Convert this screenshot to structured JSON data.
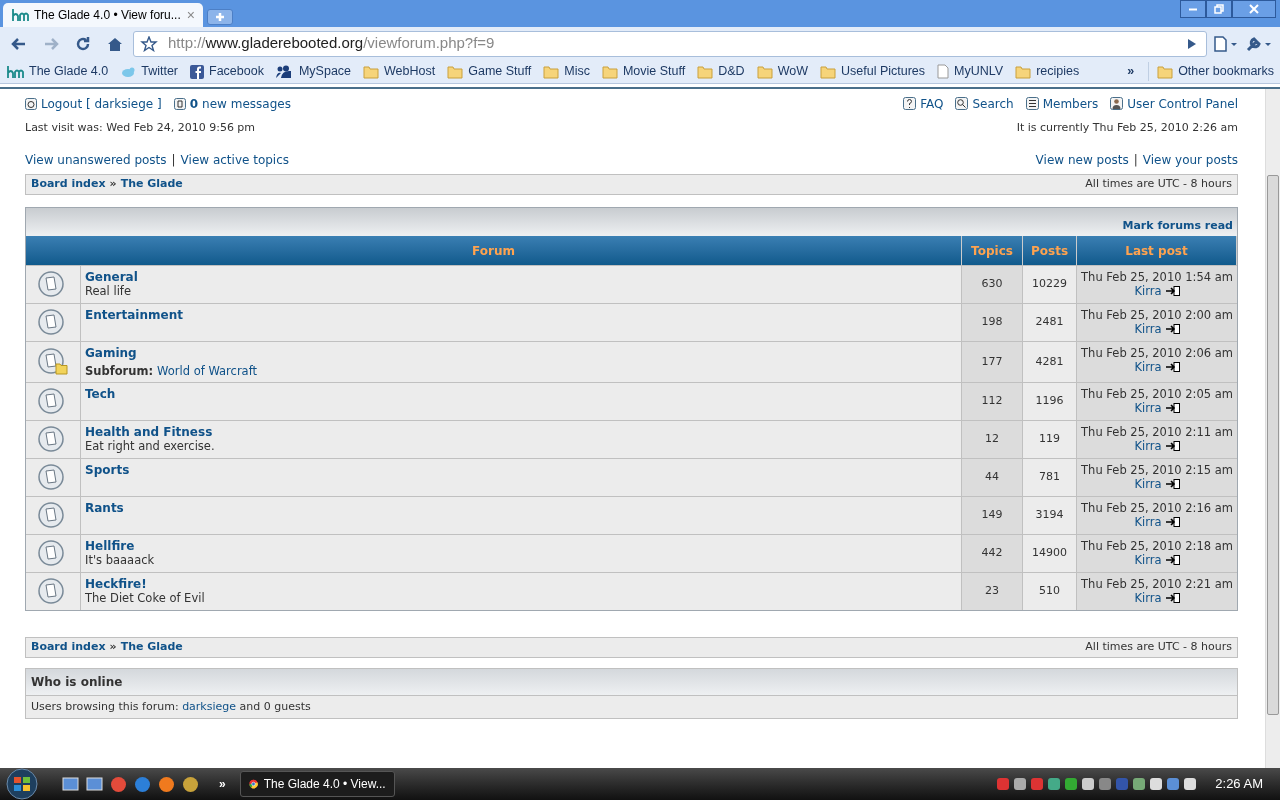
{
  "browser": {
    "tab_title": "The Glade 4.0 • View foru...",
    "tab_close": "×",
    "address": {
      "scheme": "http://",
      "domain": "www.gladerebooted.org",
      "path": "/viewforum.php?f=9"
    },
    "bookmarks": [
      {
        "label": "The Glade 4.0",
        "kind": "site"
      },
      {
        "label": "Twitter",
        "kind": "twitter"
      },
      {
        "label": "Facebook",
        "kind": "facebook"
      },
      {
        "label": "MySpace",
        "kind": "myspace"
      },
      {
        "label": "WebHost",
        "kind": "folder"
      },
      {
        "label": "Game Stuff",
        "kind": "folder"
      },
      {
        "label": "Misc",
        "kind": "folder"
      },
      {
        "label": "Movie Stuff",
        "kind": "folder"
      },
      {
        "label": "D&D",
        "kind": "folder"
      },
      {
        "label": "WoW",
        "kind": "folder"
      },
      {
        "label": "Useful Pictures",
        "kind": "folder"
      },
      {
        "label": "MyUNLV",
        "kind": "page"
      },
      {
        "label": "recipies",
        "kind": "folder"
      }
    ],
    "bookmarks_overflow": "»",
    "other_bookmarks": "Other bookmarks"
  },
  "header": {
    "logout": "Logout [ darksiege ]",
    "message_count": "0",
    "message_label": "new messages",
    "nav": [
      {
        "label": "FAQ",
        "kind": "faq"
      },
      {
        "label": "Search",
        "kind": "search"
      },
      {
        "label": "Members",
        "kind": "members"
      },
      {
        "label": "User Control Panel",
        "kind": "ucp"
      }
    ],
    "last_visit": "Last visit was: Wed Feb 24, 2010 9:56 pm",
    "current_time": "It is currently Thu Feb 25, 2010 2:26 am",
    "link_separator": "|",
    "links_left": [
      "View unanswered posts",
      "View active topics"
    ],
    "links_right": [
      "View new posts",
      "View your posts"
    ]
  },
  "breadcrumb": {
    "items": [
      "Board index",
      "The Glade"
    ],
    "separator": "»",
    "timezone": "All times are UTC - 8 hours"
  },
  "mark_read": "Mark forums read",
  "columns": [
    "Forum",
    "Topics",
    "Posts",
    "Last post"
  ],
  "forums": [
    {
      "name": "General",
      "description": "Real life",
      "topics": "630",
      "posts": "10229",
      "last_date": "Thu Feb 25, 2010 1:54 am",
      "last_user": "Kirra",
      "has_subforum": false
    },
    {
      "name": "Entertainment",
      "topics": "198",
      "posts": "2481",
      "last_date": "Thu Feb 25, 2010 2:00 am",
      "last_user": "Kirra",
      "has_subforum": false
    },
    {
      "name": "Gaming",
      "subforum_label": "Subforum:",
      "subforum": "World of Warcraft",
      "topics": "177",
      "posts": "4281",
      "last_date": "Thu Feb 25, 2010 2:06 am",
      "last_user": "Kirra",
      "has_subforum": true
    },
    {
      "name": "Tech",
      "topics": "112",
      "posts": "1196",
      "last_date": "Thu Feb 25, 2010 2:05 am",
      "last_user": "Kirra",
      "has_subforum": false
    },
    {
      "name": "Health and Fitness",
      "description": "Eat right and exercise.",
      "topics": "12",
      "posts": "119",
      "last_date": "Thu Feb 25, 2010 2:11 am",
      "last_user": "Kirra",
      "has_subforum": false
    },
    {
      "name": "Sports",
      "topics": "44",
      "posts": "781",
      "last_date": "Thu Feb 25, 2010 2:15 am",
      "last_user": "Kirra",
      "has_subforum": false
    },
    {
      "name": "Rants",
      "topics": "149",
      "posts": "3194",
      "last_date": "Thu Feb 25, 2010 2:16 am",
      "last_user": "Kirra",
      "has_subforum": false
    },
    {
      "name": "Hellfire",
      "description": "It's baaaack",
      "topics": "442",
      "posts": "14900",
      "last_date": "Thu Feb 25, 2010 2:18 am",
      "last_user": "Kirra",
      "has_subforum": false
    },
    {
      "name": "Heckfire!",
      "description": "The Diet Coke of Evil",
      "topics": "23",
      "posts": "510",
      "last_date": "Thu Feb 25, 2010 2:21 am",
      "last_user": "Kirra",
      "has_subforum": false
    }
  ],
  "footer_breadcrumb": {
    "items": [
      "Board index",
      "The Glade"
    ],
    "separator": "»",
    "timezone": "All times are UTC - 8 hours"
  },
  "who_is_online": {
    "title": "Who is online",
    "before": "Users browsing this forum: ",
    "user": "darksiege",
    "after": " and 0 guests"
  },
  "taskbar": {
    "overflow": "»",
    "window_title": "The Glade 4.0 • View...",
    "clock": "2:26 AM"
  }
}
